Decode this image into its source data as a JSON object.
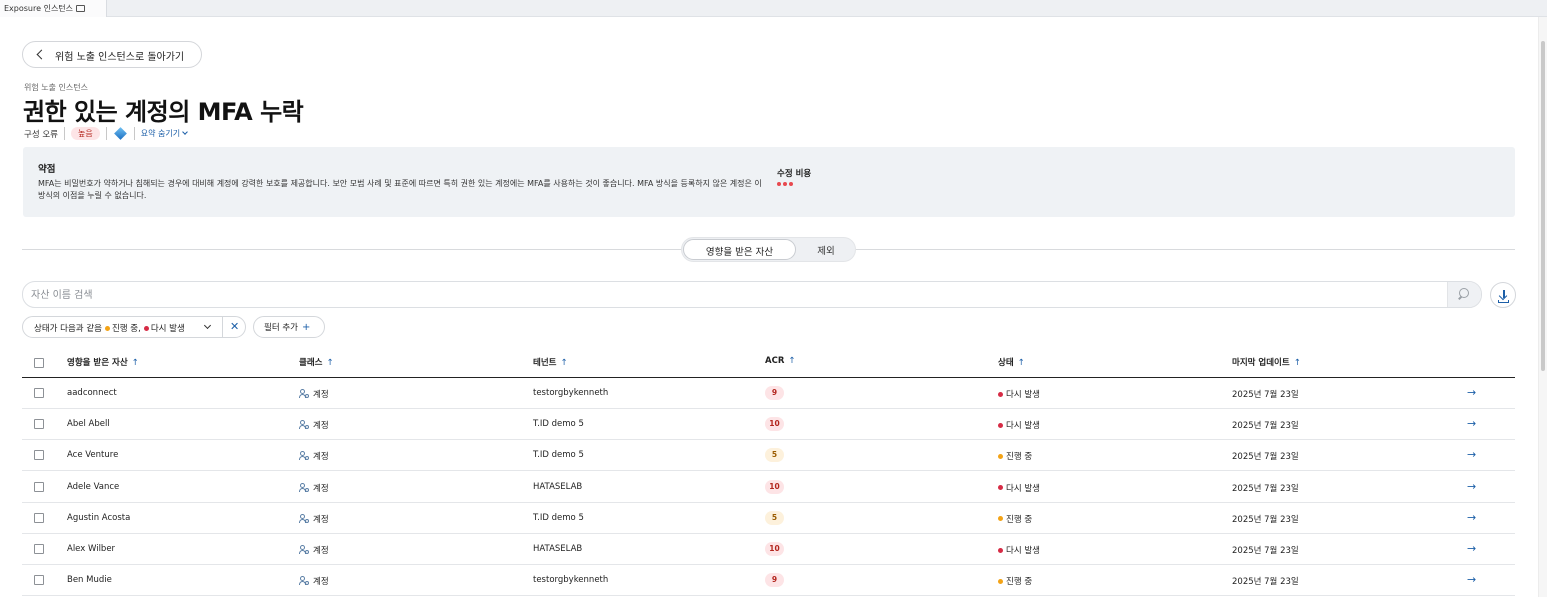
{
  "tab": {
    "label": "Exposure 인스턴스"
  },
  "back_button": {
    "label": "위험 노출 인스턴스로 돌아가기"
  },
  "breadcrumb": "위험 노출 인스턴스",
  "title": "권한 있는 계정의 MFA 누락",
  "meta": {
    "category": "구성 오류",
    "severity": "높음",
    "summary_toggle": "요약 숨기기"
  },
  "weakness": {
    "heading": "약점",
    "text": "MFA는 비밀번호가 약하거나 침해되는 경우에 대비해 계정에 강력한 보호를 제공합니다. 보안 모범 사례 및 표준에 따르면 특히 권한 있는 계정에는 MFA를 사용하는 것이 좋습니다. MFA 방식을 등록하지 않은 계정은 이 방식의 이점을 누릴 수 없습니다.",
    "cost_heading": "수정 비용",
    "cost_level": 3
  },
  "segments": {
    "affected": "영향을 받은 자산",
    "excluded": "제외"
  },
  "search": {
    "placeholder": "자산 이름 검색"
  },
  "filter": {
    "prefix": "상태가 다음과 같음",
    "v1": "진행 중,",
    "v2": "다시 발생",
    "add": "필터 추가"
  },
  "columns": {
    "asset": "영향을 받은 자산",
    "class": "클래스",
    "tenant": "테넌트",
    "acr": "ACR",
    "status": "상태",
    "updated": "마지막 업데이트"
  },
  "colors": {
    "accent": "#1c5fa8",
    "recur": "#d62b45",
    "progress": "#f3a316"
  },
  "rows": [
    {
      "asset": "aadconnect",
      "class": "계정",
      "tenant": "testorgbykenneth",
      "acr": "9",
      "status": "다시 발생",
      "status_kind": "recur",
      "updated": "2025년 7월 23일"
    },
    {
      "asset": "Abel Abell",
      "class": "계정",
      "tenant": "T.ID demo 5",
      "acr": "10",
      "status": "다시 발생",
      "status_kind": "recur",
      "updated": "2025년 7월 23일"
    },
    {
      "asset": "Ace Venture",
      "class": "계정",
      "tenant": "T.ID demo 5",
      "acr": "5",
      "status": "진행 중",
      "status_kind": "progress",
      "updated": "2025년 7월 23일"
    },
    {
      "asset": "Adele Vance",
      "class": "계정",
      "tenant": "HATASELAB",
      "acr": "10",
      "status": "다시 발생",
      "status_kind": "recur",
      "updated": "2025년 7월 23일"
    },
    {
      "asset": "Agustin Acosta",
      "class": "계정",
      "tenant": "T.ID demo 5",
      "acr": "5",
      "status": "진행 중",
      "status_kind": "progress",
      "updated": "2025년 7월 23일"
    },
    {
      "asset": "Alex Wilber",
      "class": "계정",
      "tenant": "HATASELAB",
      "acr": "10",
      "status": "다시 발생",
      "status_kind": "recur",
      "updated": "2025년 7월 23일"
    },
    {
      "asset": "Ben Mudie",
      "class": "계정",
      "tenant": "testorgbykenneth",
      "acr": "9",
      "status": "진행 중",
      "status_kind": "progress",
      "updated": "2025년 7월 23일"
    }
  ]
}
